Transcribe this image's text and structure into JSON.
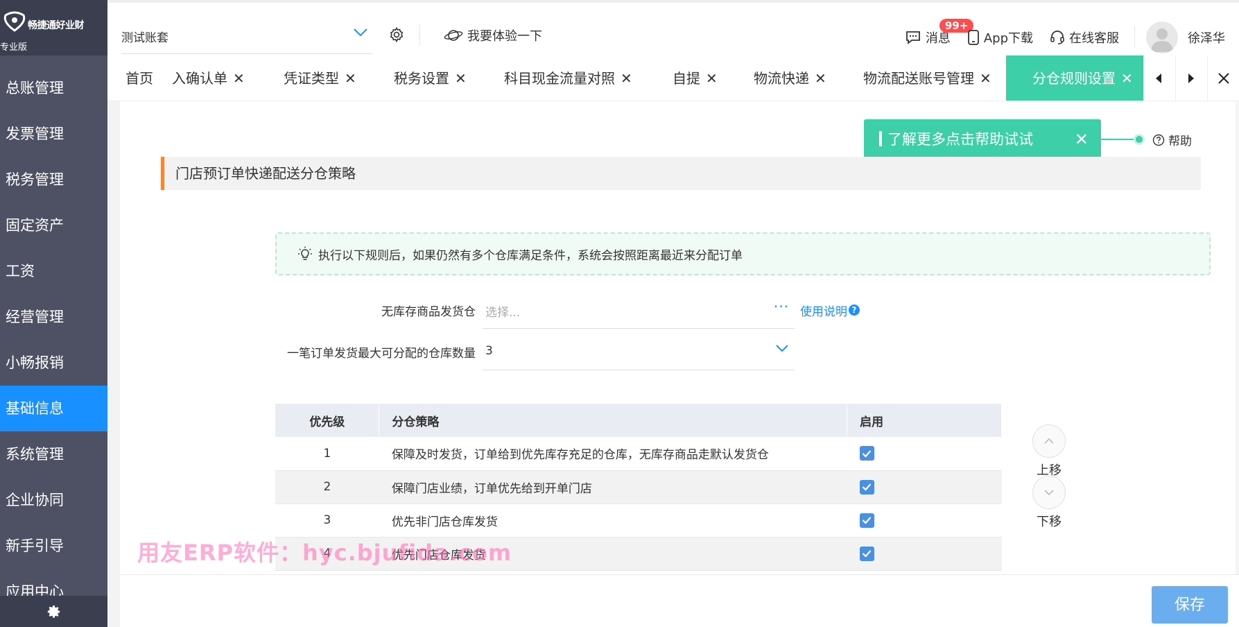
{
  "app": {
    "brand": "畅捷通好业财",
    "edition": "专业版"
  },
  "sidebar": {
    "items": [
      {
        "label": "总账管理"
      },
      {
        "label": "发票管理"
      },
      {
        "label": "税务管理"
      },
      {
        "label": "固定资产"
      },
      {
        "label": "工资"
      },
      {
        "label": "经营管理"
      },
      {
        "label": "小畅报销"
      },
      {
        "label": "基础信息",
        "active": true
      },
      {
        "label": "系统管理"
      },
      {
        "label": "企业协同"
      },
      {
        "label": "新手引导"
      },
      {
        "label": "应用中心"
      }
    ],
    "settings_icon": "gear-icon"
  },
  "topbar": {
    "account": "测试账套",
    "try_label": "我要体验一下",
    "messages_label": "消息",
    "messages_badge": "99+",
    "app_download_label": "App下载",
    "online_service_label": "在线客服",
    "user_name": "徐泽华"
  },
  "tabs": [
    {
      "label": "首页",
      "closable": false
    },
    {
      "label": "入确认单",
      "closable": true
    },
    {
      "label": "凭证类型",
      "closable": true
    },
    {
      "label": "税务设置",
      "closable": true
    },
    {
      "label": "科目现金流量对照",
      "closable": true
    },
    {
      "label": "自提",
      "closable": true
    },
    {
      "label": "物流快递",
      "closable": true
    },
    {
      "label": "物流配送账号管理",
      "closable": true
    },
    {
      "label": "分仓规则设置",
      "closable": true,
      "active": true
    }
  ],
  "help": {
    "popover": "了解更多点击帮助试试",
    "link": "帮助"
  },
  "section": {
    "title": "门店预订单快递配送分仓策略"
  },
  "tip": "执行以下规则后，如果仍然有多个仓库满足条件，系统会按照距离最近来分配订单",
  "form": {
    "no_stock_warehouse_label": "无库存商品发货仓",
    "no_stock_warehouse_placeholder": "选择...",
    "usage_link": "使用说明",
    "max_warehouse_label": "一笔订单发货最大可分配的仓库数量",
    "max_warehouse_value": "3"
  },
  "table": {
    "headers": [
      "优先级",
      "分仓策略",
      "启用"
    ],
    "rows": [
      {
        "priority": "1",
        "strategy": "保障及时发货，订单给到优先库存充足的仓库，无库存商品走默认发货仓",
        "enabled": true
      },
      {
        "priority": "2",
        "strategy": "保障门店业绩，订单优先给到开单门店",
        "enabled": true
      },
      {
        "priority": "3",
        "strategy": "优先非门店仓库发货",
        "enabled": true
      },
      {
        "priority": "4",
        "strategy": "优先门店仓库发货",
        "enabled": true
      }
    ]
  },
  "move": {
    "up": "上移",
    "down": "下移"
  },
  "footer": {
    "save_label": "保存"
  },
  "watermark": "用友ERP软件：hyc.bjufida.com",
  "colors": {
    "sidebar_bg": "#4d5163",
    "active_nav": "#1890ff",
    "active_tab": "#3dcfa8",
    "section_accent": "#f0883a",
    "save_button": "#6aaeef"
  }
}
